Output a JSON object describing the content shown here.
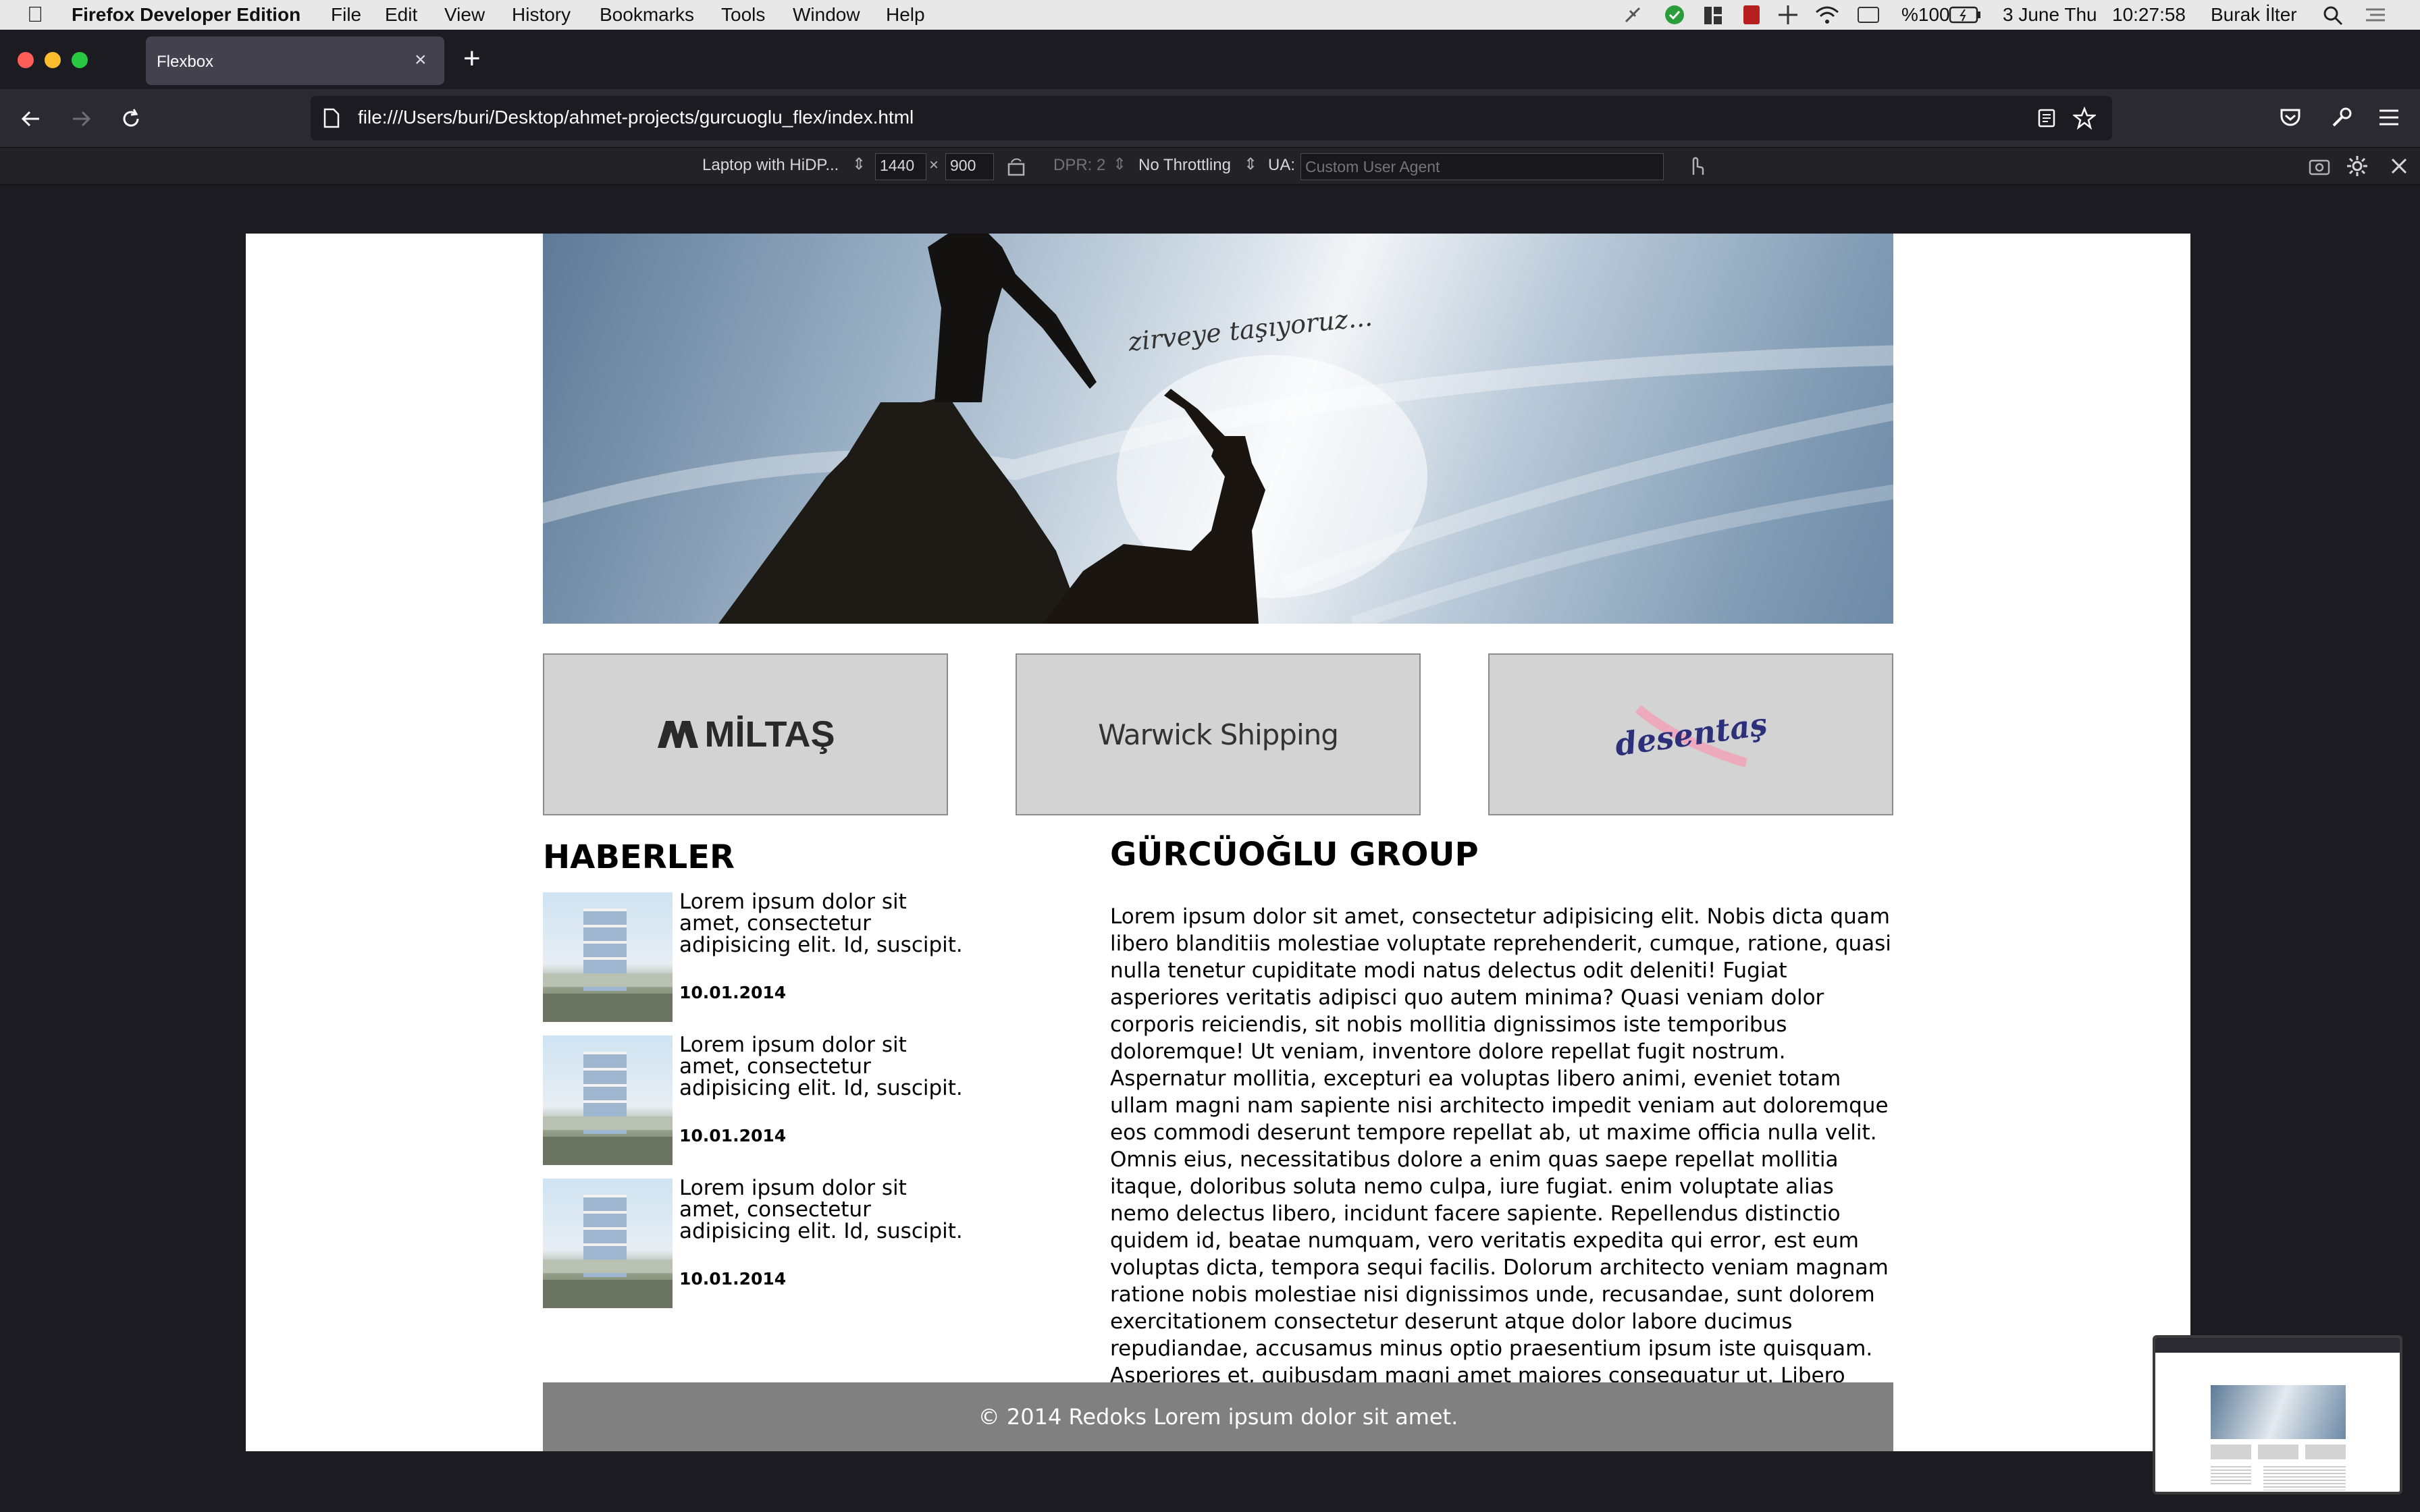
{
  "menubar": {
    "app_name": "Firefox Developer Edition",
    "menus": [
      "File",
      "Edit",
      "View",
      "History",
      "Bookmarks",
      "Tools",
      "Window",
      "Help"
    ],
    "battery": "%100",
    "date": "3 June Thu",
    "time": "10:27:58",
    "user": "Burak İlter"
  },
  "tab": {
    "title": "Flexbox",
    "close": "×",
    "new_tab": "+"
  },
  "nav": {
    "url": "file:///Users/buri/Desktop/ahmet-projects/gurcuoglu_flex/index.html"
  },
  "rdm": {
    "device": "Laptop with HiDP...",
    "width": "1440",
    "times": "×",
    "height": "900",
    "dpr": "DPR: 2",
    "throttling": "No Throttling",
    "ua_label": "UA:",
    "ua_placeholder": "Custom User Agent"
  },
  "page": {
    "hero_caption": "zirveye taşıyoruz...",
    "logos": {
      "miltas": "MİLTAŞ",
      "warwick": "Warwick Shipping",
      "desentas": "desentaş"
    },
    "news": {
      "heading": "HABERLER",
      "items": [
        {
          "text": "Lorem ipsum dolor sit amet, consectetur adipisicing elit. Id, suscipit.",
          "date": "10.01.2014"
        },
        {
          "text": "Lorem ipsum dolor sit amet, consectetur adipisicing elit. Id, suscipit.",
          "date": "10.01.2014"
        },
        {
          "text": "Lorem ipsum dolor sit amet, consectetur adipisicing elit. Id, suscipit.",
          "date": "10.01.2014"
        }
      ]
    },
    "about": {
      "heading": "GÜRCÜOĞLU GROUP",
      "body": "Lorem ipsum dolor sit amet, consectetur adipisicing elit. Nobis dicta quam libero blanditiis molestiae voluptate reprehenderit, cumque, ratione, quasi nulla tenetur cupiditate modi natus delectus odit deleniti! Fugiat asperiores veritatis adipisci quo autem minima? Quasi veniam dolor corporis reiciendis, sit nobis mollitia dignissimos iste temporibus doloremque! Ut veniam, inventore dolore repellat fugit nostrum. Aspernatur mollitia, excepturi ea voluptas libero animi, eveniet totam ullam magni nam sapiente nisi architecto impedit veniam aut doloremque eos commodi deserunt tempore repellat ab, ut maxime officia nulla velit. Omnis eius, necessitatibus dolore a enim quas saepe repellat mollitia itaque, doloribus soluta nemo culpa, iure fugiat. enim voluptate alias nemo delectus libero, incidunt facere sapiente. Repellendus distinctio quidem id, beatae numquam, vero veritatis expedita qui error, est eum voluptas dicta, tempora sequi facilis. Dolorum architecto veniam magnam ratione nobis molestiae nisi dignissimos unde, recusandae, sunt dolorem exercitationem consectetur deserunt atque dolor labore ducimus repudiandae, accusamus minus optio praesentium ipsum iste quisquam. Asperiores et, quibusdam magni amet maiores consequatur ut. Libero mollitia perspiciatis sapiente adipisci asperiores nam veritatis dolorum excepturi, minus eaque minima quaerat suscipit."
    },
    "footer": "© 2014 Redoks Lorem ipsum dolor sit amet."
  },
  "colors": {
    "chrome_dark": "#1c1b22",
    "tab_active": "#42414d",
    "footer_gray": "#808080",
    "logo_box": "#d3d3d3"
  }
}
